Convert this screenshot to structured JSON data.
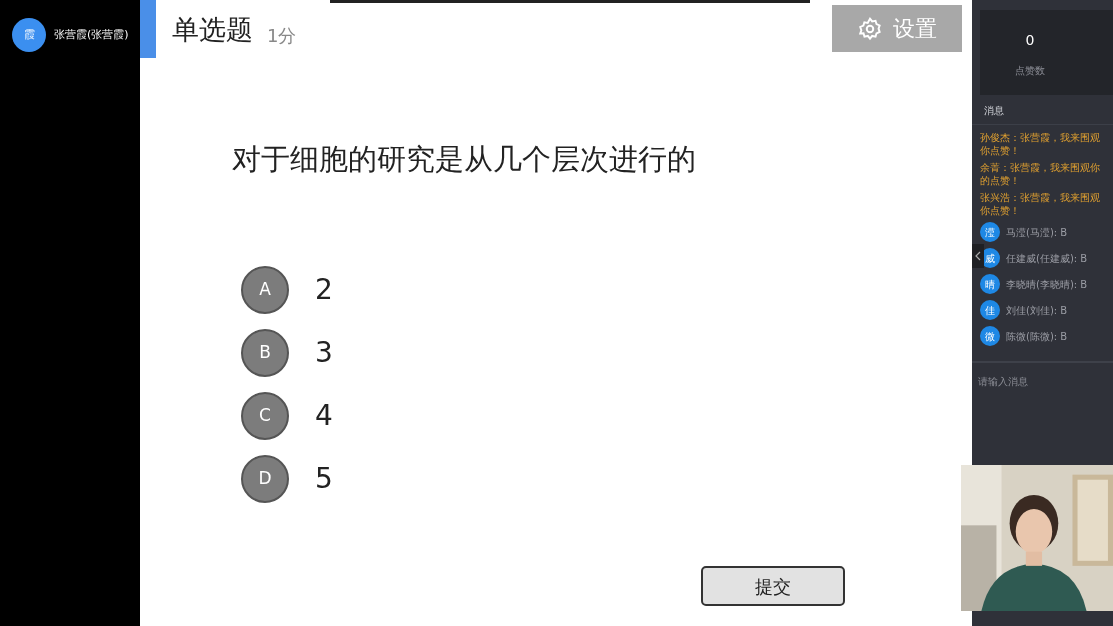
{
  "presenter": {
    "avatar": "霞",
    "name": "张营霞(张营霞)"
  },
  "question": {
    "type": "单选题",
    "score": "1分",
    "text": "对于细胞的研究是从几个层次进行的",
    "options": [
      {
        "letter": "A",
        "value": "2"
      },
      {
        "letter": "B",
        "value": "3"
      },
      {
        "letter": "C",
        "value": "4"
      },
      {
        "letter": "D",
        "value": "5"
      }
    ]
  },
  "settings_button": "设置",
  "submit_button": "提交",
  "side_panel": {
    "stats": [
      {
        "value": "0",
        "label": "点赞数"
      }
    ],
    "messages_title": "消息",
    "messages": [
      {
        "kind": "like",
        "text": "孙俊杰：张营霞，我来围观你点赞！"
      },
      {
        "kind": "like",
        "text": "余菁：张营霞，我来围观你的点赞！"
      },
      {
        "kind": "like",
        "text": "张兴浩：张营霞，我来围观你点赞！"
      },
      {
        "kind": "answer",
        "avatar": "滢",
        "text": "马滢(马滢): B"
      },
      {
        "kind": "answer",
        "avatar": "威",
        "text": "任建威(任建威): B"
      },
      {
        "kind": "answer",
        "avatar": "晴",
        "text": "李晓晴(李晓晴): B"
      },
      {
        "kind": "answer",
        "avatar": "佳",
        "text": "刘佳(刘佳): B"
      },
      {
        "kind": "answer",
        "avatar": "微",
        "text": "陈微(陈微): B"
      }
    ],
    "input": {
      "placeholder": "请输入消息"
    }
  }
}
